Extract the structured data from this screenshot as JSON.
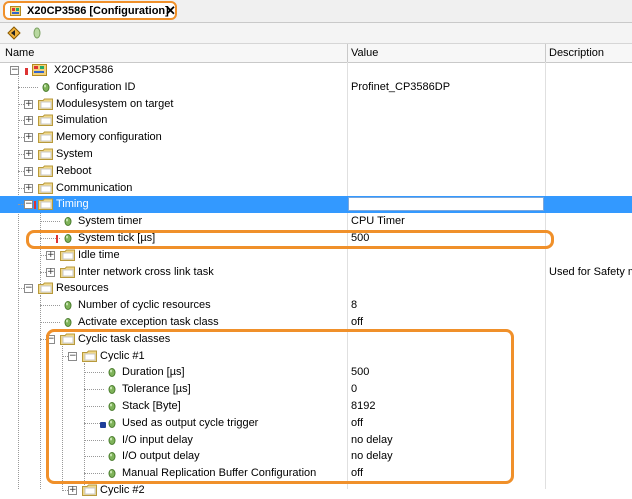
{
  "tab": {
    "title": "X20CP3586 [Configuration]",
    "close": "✕"
  },
  "toolbar": {
    "buttons": [
      "navigate-icon",
      "leaf-icon"
    ]
  },
  "header": {
    "name": "Name",
    "value": "Value",
    "description": "Description"
  },
  "tree": {
    "root": {
      "label": "X20CP3586"
    },
    "rows": [
      {
        "label": "Configuration ID",
        "value": "Profinet_CP3586DP"
      },
      {
        "label": "Modulesystem on target"
      },
      {
        "label": "Simulation"
      },
      {
        "label": "Memory configuration"
      },
      {
        "label": "System"
      },
      {
        "label": "Reboot"
      },
      {
        "label": "Communication"
      },
      {
        "label": "Timing"
      },
      {
        "label": "System timer",
        "value": "CPU Timer"
      },
      {
        "label": "System tick [µs]",
        "value": "500"
      },
      {
        "label": "Idle time"
      },
      {
        "label": "Inter network cross link task",
        "description": "Used for Safety mo"
      },
      {
        "label": "Resources"
      },
      {
        "label": "Number of cyclic resources",
        "value": "8"
      },
      {
        "label": "Activate exception task class",
        "value": "off"
      },
      {
        "label": "Cyclic task classes"
      },
      {
        "label": "Cyclic #1"
      },
      {
        "label": "Duration [µs]",
        "value": "500"
      },
      {
        "label": "Tolerance [µs]",
        "value": "0"
      },
      {
        "label": "Stack [Byte]",
        "value": "8192"
      },
      {
        "label": "Used as output cycle trigger",
        "value": "off"
      },
      {
        "label": "I/O input delay",
        "value": "no delay"
      },
      {
        "label": "I/O output delay",
        "value": "no delay"
      },
      {
        "label": "Manual Replication Buffer Configuration",
        "value": "off"
      },
      {
        "label": "Cyclic #2"
      }
    ]
  },
  "colors": {
    "selection": "#3399ff",
    "highlight": "#f0902a",
    "leaf": "#5a9a3a",
    "folder": "#e9c96a"
  }
}
